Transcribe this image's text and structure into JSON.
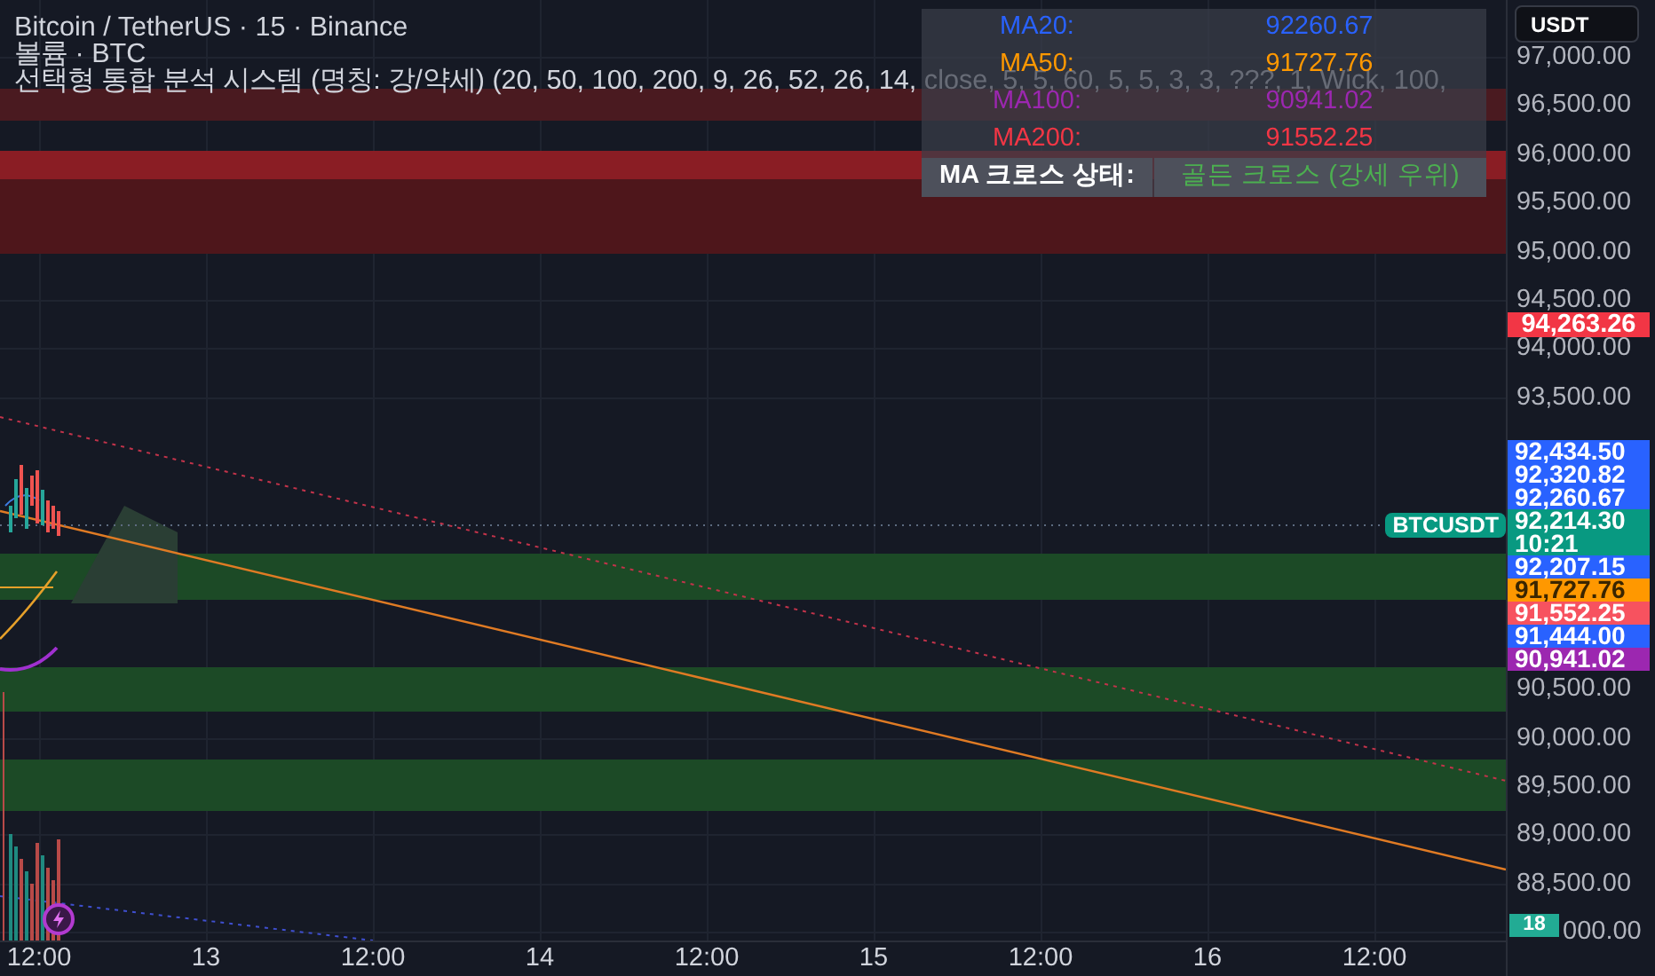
{
  "legend": {
    "title": "Bitcoin / TetherUS · 15 · Binance",
    "volume": "볼륨 · BTC",
    "indicator": "선택형 통합 분석 시스템 (명칭: 강/약세) (20, 50, 100, 200, 9, 26, 52, 26, 14, close, 5, 5, 60, 5, 5, 3, 3, ???, 1, Wick, 100,"
  },
  "ma_table": {
    "rows": [
      {
        "label": "MA20:",
        "value": "92260.67",
        "color": "#2962ff"
      },
      {
        "label": "MA50:",
        "value": "91727.76",
        "color": "#ff9800"
      },
      {
        "label": "MA100:",
        "value": "90941.02",
        "color": "#9c27b0"
      },
      {
        "label": "MA200:",
        "value": "91552.25",
        "color": "#f23645"
      }
    ],
    "status_label": "MA 크로스 상태:",
    "status_value": "골든 크로스 (강세 우위)"
  },
  "currency_button": "USDT",
  "price_axis": [
    "97,000.00",
    "96,500.00",
    "96,000.00",
    "95,500.00",
    "95,000.00",
    "94,500.00",
    "94,000.00",
    "93,500.00",
    "90,500.00",
    "90,000.00",
    "89,500.00",
    "89,000.00",
    "88,500.00",
    "000.00"
  ],
  "high_badge": {
    "text": "94,263.26",
    "color": "#f23645"
  },
  "price_badges": [
    {
      "text": "92,434.50",
      "color": "#2962ff"
    },
    {
      "text": "92,320.82",
      "color": "#2962ff"
    },
    {
      "text": "92,260.67",
      "color": "#2962ff"
    },
    {
      "text": "92,214.30",
      "sub": "10:21",
      "color": "#089981"
    },
    {
      "text": "92,207.15",
      "color": "#2962ff"
    },
    {
      "text": "91,727.76",
      "color": "#ff9800"
    },
    {
      "text": "91,552.25",
      "color": "#f7525f"
    },
    {
      "text": "91,444.00",
      "color": "#2962ff"
    },
    {
      "text": "90,941.02",
      "color": "#9c27b0"
    }
  ],
  "symbol_tag": "BTCUSDT",
  "volume_badge": "18",
  "time_axis": [
    "12:00",
    "13",
    "12:00",
    "14",
    "12:00",
    "15",
    "12:00",
    "16",
    "12:00"
  ]
}
